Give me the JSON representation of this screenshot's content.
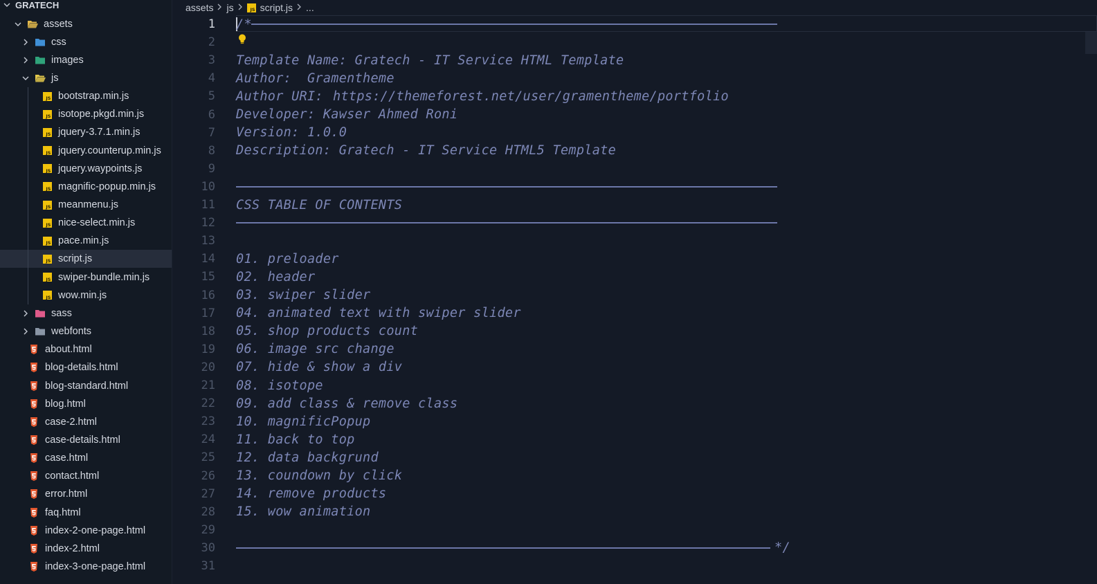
{
  "sidebar": {
    "root_label": "GRATECH",
    "items": [
      {
        "label": "assets",
        "kind": "folder-open",
        "depth": 1
      },
      {
        "label": "css",
        "kind": "folder-css",
        "depth": 2
      },
      {
        "label": "images",
        "kind": "folder-images",
        "depth": 2
      },
      {
        "label": "js",
        "kind": "folder-js-open",
        "depth": 2
      },
      {
        "label": "bootstrap.min.js",
        "kind": "js",
        "depth": 3
      },
      {
        "label": "isotope.pkgd.min.js",
        "kind": "js",
        "depth": 3
      },
      {
        "label": "jquery-3.7.1.min.js",
        "kind": "js",
        "depth": 3
      },
      {
        "label": "jquery.counterup.min.js",
        "kind": "js",
        "depth": 3
      },
      {
        "label": "jquery.waypoints.js",
        "kind": "js",
        "depth": 3
      },
      {
        "label": "magnific-popup.min.js",
        "kind": "js",
        "depth": 3
      },
      {
        "label": "meanmenu.js",
        "kind": "js",
        "depth": 3
      },
      {
        "label": "nice-select.min.js",
        "kind": "js",
        "depth": 3
      },
      {
        "label": "pace.min.js",
        "kind": "js",
        "depth": 3
      },
      {
        "label": "script.js",
        "kind": "js",
        "depth": 3,
        "selected": true
      },
      {
        "label": "swiper-bundle.min.js",
        "kind": "js",
        "depth": 3
      },
      {
        "label": "wow.min.js",
        "kind": "js",
        "depth": 3
      },
      {
        "label": "sass",
        "kind": "folder-sass",
        "depth": 2
      },
      {
        "label": "webfonts",
        "kind": "folder",
        "depth": 2
      },
      {
        "label": "about.html",
        "kind": "html",
        "depth": 1
      },
      {
        "label": "blog-details.html",
        "kind": "html",
        "depth": 1
      },
      {
        "label": "blog-standard.html",
        "kind": "html",
        "depth": 1
      },
      {
        "label": "blog.html",
        "kind": "html",
        "depth": 1
      },
      {
        "label": "case-2.html",
        "kind": "html",
        "depth": 1
      },
      {
        "label": "case-details.html",
        "kind": "html",
        "depth": 1
      },
      {
        "label": "case.html",
        "kind": "html",
        "depth": 1
      },
      {
        "label": "contact.html",
        "kind": "html",
        "depth": 1
      },
      {
        "label": "error.html",
        "kind": "html",
        "depth": 1
      },
      {
        "label": "faq.html",
        "kind": "html",
        "depth": 1
      },
      {
        "label": "index-2-one-page.html",
        "kind": "html",
        "depth": 1
      },
      {
        "label": "index-2.html",
        "kind": "html",
        "depth": 1
      },
      {
        "label": "index-3-one-page.html",
        "kind": "html",
        "depth": 1
      }
    ]
  },
  "breadcrumb": {
    "parts": [
      "assets",
      "js",
      "script.js",
      "..."
    ]
  },
  "editor": {
    "current_line": 1,
    "lines": [
      {
        "n": "1",
        "text": "/*",
        "rule": "top"
      },
      {
        "n": "2",
        "text": "",
        "bulb": true
      },
      {
        "n": "3",
        "text": "Template Name: Gratech - IT Service HTML Template"
      },
      {
        "n": "4",
        "text": "Author:  Gramentheme"
      },
      {
        "n": "5",
        "text": "Author URI: ",
        "link": "https://themeforest.net/user/gramentheme/portfolio"
      },
      {
        "n": "6",
        "text": "Developer: Kawser Ahmed Roni"
      },
      {
        "n": "7",
        "text": "Version: 1.0.0"
      },
      {
        "n": "8",
        "text": "Description: Gratech - IT Service HTML5 Template"
      },
      {
        "n": "9",
        "text": ""
      },
      {
        "n": "10",
        "text": "",
        "rule": "full"
      },
      {
        "n": "11",
        "text": "CSS TABLE OF CONTENTS"
      },
      {
        "n": "12",
        "text": "",
        "rule": "full"
      },
      {
        "n": "13",
        "text": ""
      },
      {
        "n": "14",
        "text": "01. preloader"
      },
      {
        "n": "15",
        "text": "02. header"
      },
      {
        "n": "16",
        "text": "03. swiper slider"
      },
      {
        "n": "17",
        "text": "04. animated text with swiper slider"
      },
      {
        "n": "18",
        "text": "05. shop products count"
      },
      {
        "n": "19",
        "text": "06. image src change"
      },
      {
        "n": "20",
        "text": "07. hide & show a div"
      },
      {
        "n": "21",
        "text": "08. isotope"
      },
      {
        "n": "22",
        "text": "09. add class & remove class"
      },
      {
        "n": "23",
        "text": "10. magnificPopup"
      },
      {
        "n": "24",
        "text": "11. back to top"
      },
      {
        "n": "25",
        "text": "12. data backgrund"
      },
      {
        "n": "26",
        "text": "13. coundown by click"
      },
      {
        "n": "27",
        "text": "14. remove products"
      },
      {
        "n": "28",
        "text": "15. wow animation"
      },
      {
        "n": "29",
        "text": ""
      },
      {
        "n": "30",
        "text": "*/",
        "rule": "end"
      },
      {
        "n": "31",
        "text": ""
      }
    ]
  },
  "colors": {
    "background": "#141a26",
    "sidebar": "#131a24",
    "comment": "#7d87b6",
    "js_badge": "#f0c20b",
    "html_icon": "#e4572e"
  }
}
